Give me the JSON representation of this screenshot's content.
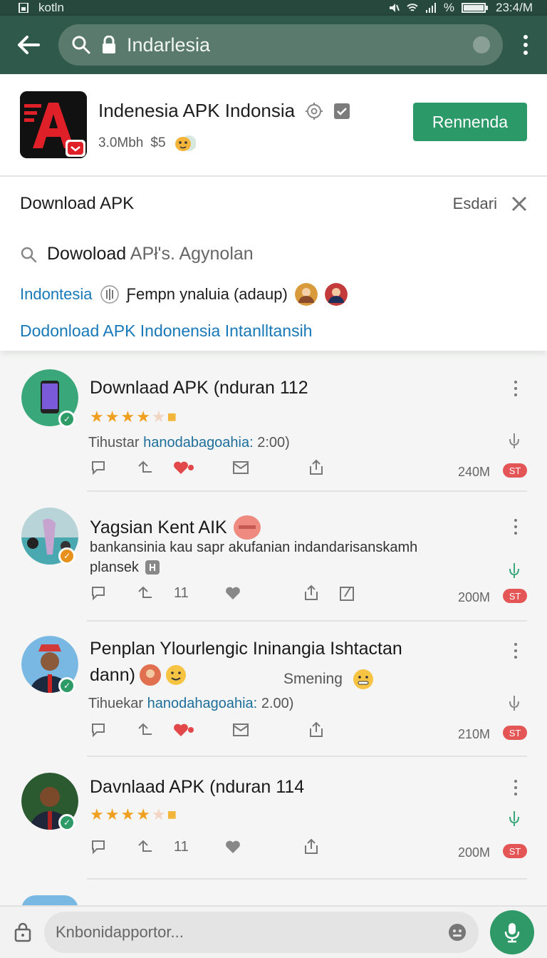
{
  "status_bar": {
    "left_text": "kotln",
    "battery_text": "%",
    "time": "23:4/M"
  },
  "toolbar": {
    "url_text": "Indarlesia"
  },
  "app": {
    "title": "Indenesia APK Indonsia",
    "meta_size": "3.0Mbh",
    "meta_price": "$5",
    "primary_button": "Rennenda"
  },
  "download_panel": {
    "title": "Download APK",
    "action_label": "Esdari",
    "search_main": "Dowoload",
    "search_rest": "APł's. Agynolan",
    "row_link": "Indontesia",
    "row_text": "Ƒempn ynaluia (adaup)",
    "link2": "Dodonload APK Indonensia  Intanlltansih"
  },
  "feed": {
    "posts": [
      {
        "title": "Downlaad APK (nduran 112",
        "meta_prefix": "Tihustar",
        "meta_link": "hanodabagoahia:",
        "meta_time": "2:00)",
        "size": "240M",
        "badge": "ST"
      },
      {
        "title": "Yagsian Kent AIK",
        "body_line1": "bankansinia kau  sapr akufanian  indandarisanskamh",
        "body_line2": "plansek",
        "count": "11",
        "size": "200M",
        "badge": "ST"
      },
      {
        "title": "Penplan Ylourlengic Ininangia  Ishtactan",
        "title_line2": "dann)",
        "side_text": "Smening",
        "meta_prefix": "Tihuekar",
        "meta_link": "hanodahagoahia:",
        "meta_time": "2.00)",
        "size": "210M",
        "badge": "ST"
      },
      {
        "title": "Davnlaad APK (nduran 114",
        "count": "11",
        "size": "200M",
        "badge": "ST"
      }
    ]
  },
  "bottom_bar": {
    "compose_placeholder": "Knbonidapportor..."
  },
  "colors": {
    "toolbar": "#2f5a4b",
    "accent": "#2b9968",
    "link": "#1878b8",
    "badge": "#e45555"
  }
}
